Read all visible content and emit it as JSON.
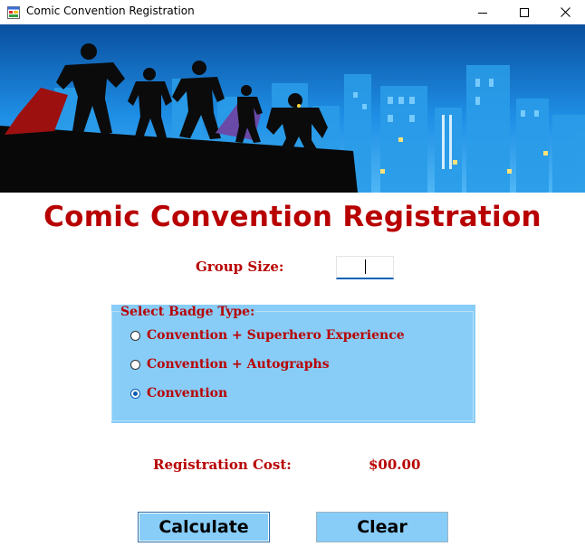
{
  "window": {
    "title": "Comic Convention Registration",
    "controls": [
      "minimize",
      "maximize",
      "close"
    ]
  },
  "banner": {
    "description_icons": [
      "superhero-silhouettes",
      "city-skyline"
    ]
  },
  "form": {
    "heading": "Comic Convention Registration",
    "group_size_label": "Group Size:",
    "group_size_value": "",
    "badge_group_label": "Select Badge Type:",
    "badge_options": [
      {
        "label": "Convention + Superhero Experience",
        "checked": false
      },
      {
        "label": "Convention + Autographs",
        "checked": false
      },
      {
        "label": "Convention",
        "checked": true
      }
    ],
    "cost_label": "Registration Cost:",
    "cost_value": "$00.00",
    "calculate_label": "Calculate",
    "clear_label": "Clear"
  },
  "colors": {
    "accent_red": "#b80000",
    "panel_blue": "#87cdf8",
    "sky_blue": "#1e8fe6"
  }
}
